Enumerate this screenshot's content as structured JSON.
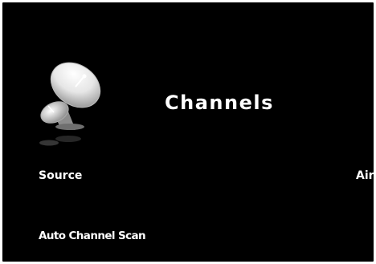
{
  "menu": {
    "title": "Channels",
    "icon": "satellite-dish-icon",
    "items": [
      {
        "label": "Source",
        "value": "Air"
      },
      {
        "label": "Auto Channel Scan"
      }
    ]
  },
  "colors": {
    "background": "#000000",
    "text": "#ffffff",
    "frame": "#ffffff"
  }
}
